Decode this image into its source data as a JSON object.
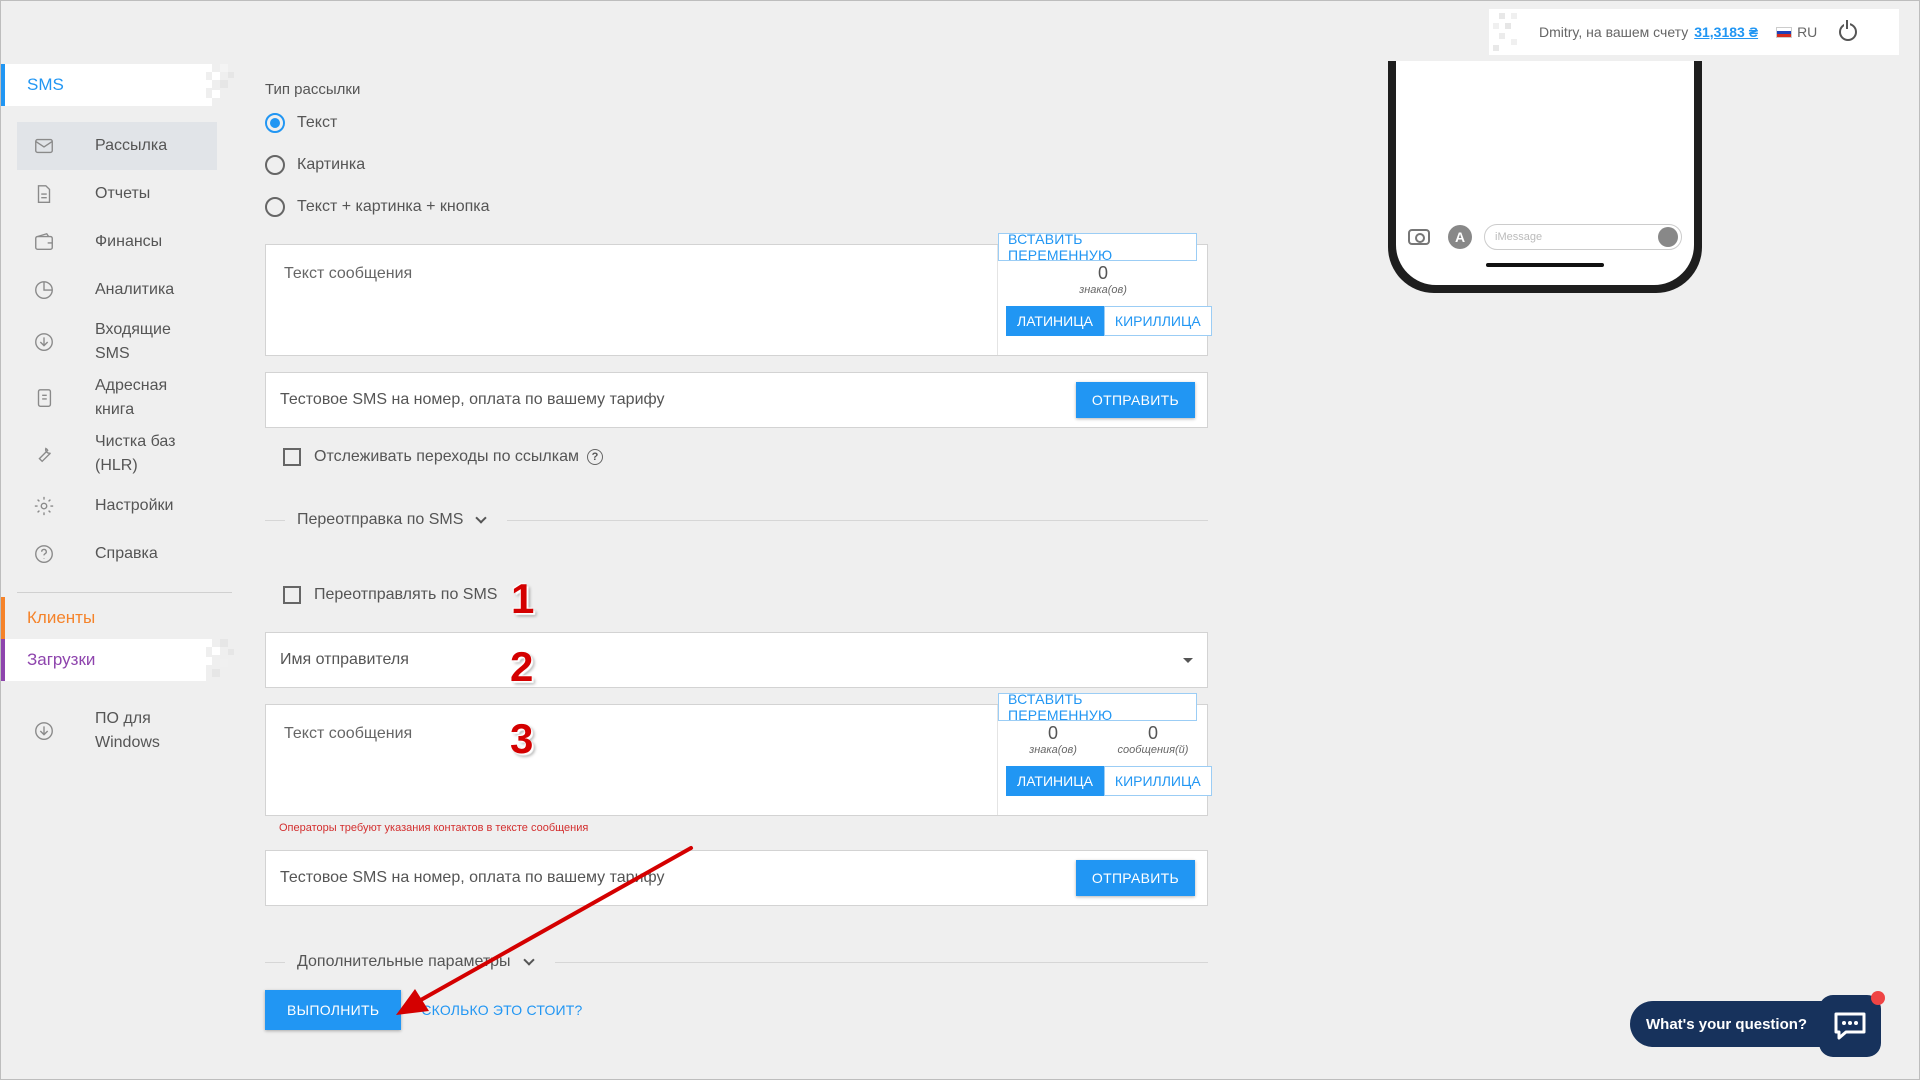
{
  "topbar": {
    "user_text": "Dmitry, на вашем счету",
    "balance": "31,3183 ₴",
    "lang": "RU"
  },
  "sidebar": {
    "sms_section": "SMS",
    "items": [
      {
        "label": "Рассылка",
        "icon": "envelope-icon"
      },
      {
        "label": "Отчеты",
        "icon": "document-icon"
      },
      {
        "label": "Финансы",
        "icon": "wallet-icon"
      },
      {
        "label": "Аналитика",
        "icon": "pie-chart-icon"
      },
      {
        "label": "Входящие SMS",
        "icon": "download-circle-icon"
      },
      {
        "label": "Адресная книга",
        "icon": "address-book-icon"
      },
      {
        "label": "Чистка баз (HLR)",
        "icon": "wrench-icon"
      },
      {
        "label": "Настройки",
        "icon": "gear-icon"
      },
      {
        "label": "Справка",
        "icon": "help-circle-icon"
      }
    ],
    "clients_section": "Клиенты",
    "downloads_section": "Загрузки",
    "downloads_item": "ПО для Windows"
  },
  "form": {
    "type_label": "Тип рассылки",
    "radios": [
      "Текст",
      "Картинка",
      "Текст + картинка + кнопка"
    ],
    "selected_radio": "Текст",
    "message_placeholder": "Текст сообщения",
    "insert_variable": "ВСТАВИТЬ ПЕРЕМЕННУЮ",
    "char_count": "0",
    "char_unit": "знака(ов)",
    "msg_count": "0",
    "msg_unit": "сообщения(й)",
    "latin": "ЛАТИНИЦА",
    "cyrillic": "КИРИЛЛИЦА",
    "test_sms": "Тестовое SMS на номер, оплата по вашему тарифу",
    "send": "ОТПРАВИТЬ",
    "track_links": "Отслеживать переходы по ссылкам",
    "resend_section": "Переотправка по SMS",
    "resend_checkbox": "Переотправлять по SMS",
    "sender_name": "Имя отправителя",
    "operators_warning": "Операторы требуют указания контактов в тексте сообщения",
    "extra_params": "Дополнительные параметры",
    "execute": "ВЫПОЛНИТЬ",
    "cost_link": "СКОЛЬКО ЭТО СТОИТ?"
  },
  "phone": {
    "imessage_placeholder": "iMessage"
  },
  "annotations": [
    "1",
    "2",
    "3"
  ],
  "chat": {
    "question": "What's your question?"
  },
  "colors": {
    "accent": "#2196f3",
    "clients": "#f5832a",
    "downloads": "#8e44ad",
    "annotation": "#d40000",
    "chat": "#17325c"
  }
}
